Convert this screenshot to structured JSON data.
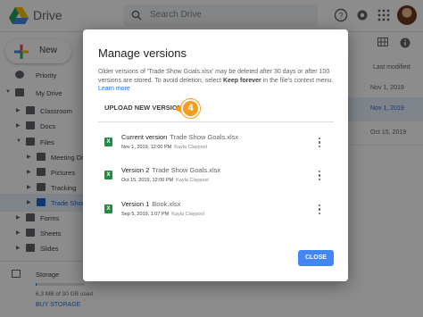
{
  "app": {
    "name": "Drive"
  },
  "search": {
    "placeholder": "Search Drive"
  },
  "toolbar": {
    "new_label": "New"
  },
  "sidebar": {
    "items": [
      {
        "label": "Priority"
      },
      {
        "label": "My Drive"
      },
      {
        "label": "Classroom"
      },
      {
        "label": "Docs"
      },
      {
        "label": "Files"
      },
      {
        "label": "Meeting Do"
      },
      {
        "label": "Pictures"
      },
      {
        "label": "Tracking"
      },
      {
        "label": "Trade Show"
      },
      {
        "label": "Forms"
      },
      {
        "label": "Sheets"
      },
      {
        "label": "Slides"
      }
    ],
    "storage": {
      "label": "Storage",
      "used_text": "6.3 MB of 30 GB used",
      "buy_label": "BUY STORAGE"
    }
  },
  "list": {
    "column_header": "Last modified",
    "dates": [
      "Nov 1, 2019",
      "Nov 1, 2019",
      "Oct 15, 2019"
    ]
  },
  "dialog": {
    "title": "Manage versions",
    "description_part1": "Older versions of 'Trade Show Goals.xlsx' may be deleted after 30 days or after 100 versions are stored. To avoid deletion, select ",
    "description_bold": "Keep forever",
    "description_part2": " in the file's context menu. ",
    "learn_more": "Learn more",
    "upload_label": "UPLOAD NEW VERSION",
    "callout_number": "4",
    "versions": [
      {
        "label": "Current version",
        "file": "Trade Show Goals.xlsx",
        "date": "Nov 1, 2019, 12:00 PM",
        "author": "Kayla Claypool"
      },
      {
        "label": "Version 2",
        "file": "Trade Show Goals.xlsx",
        "date": "Oct 15, 2019, 12:00 PM",
        "author": "Kayla Claypool"
      },
      {
        "label": "Version 1",
        "file": "Book.xlsx",
        "date": "Sep 5, 2019, 1:07 PM",
        "author": "Kayla Claypool"
      }
    ],
    "close_label": "CLOSE"
  }
}
